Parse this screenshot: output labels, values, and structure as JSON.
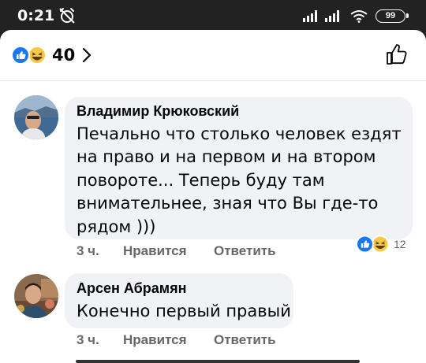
{
  "statusbar": {
    "time": "0:21",
    "battery": "99",
    "icons": [
      "alarm-off-icon",
      "signal-icon",
      "signal-icon",
      "wifi-icon",
      "battery-icon"
    ]
  },
  "reactions": {
    "count": "40",
    "icons": [
      "like-reaction-icon",
      "haha-reaction-icon"
    ]
  },
  "comments": [
    {
      "author": "Владимир Крюковский",
      "lines": [
        "Печально что столько человек ездят",
        "на право и на первом и на втором",
        "повороте... Теперь буду там",
        "внимательнее, зная что Вы где-то",
        "рядом )))"
      ],
      "time": "3 ч.",
      "like_label": "Нравится",
      "reply_label": "Ответить",
      "reaction_count": "12"
    },
    {
      "author": "Арсен Абрамян",
      "lines": [
        "Конечно первый правый"
      ],
      "time": "3 ч.",
      "like_label": "Нравится",
      "reply_label": "Ответить"
    }
  ],
  "colors": {
    "like_blue": "#1877f2",
    "haha_yellow": "#f7c843",
    "bubble_bg": "#f0f2f5",
    "meta_gray": "#65676b"
  }
}
